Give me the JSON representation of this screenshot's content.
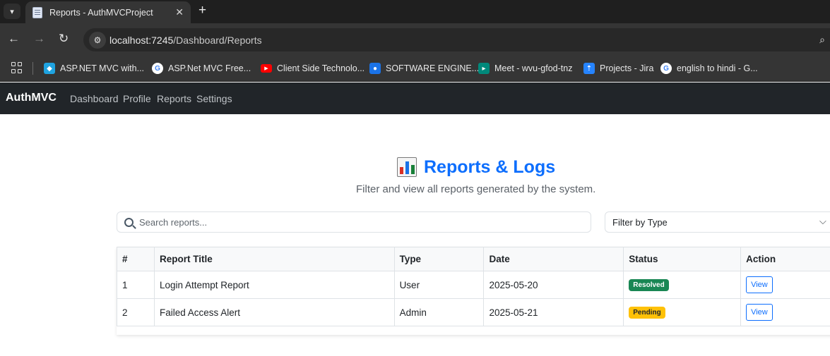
{
  "browser": {
    "tab_title": "Reports - AuthMVCProject",
    "tab_close": "✕",
    "new_tab": "+",
    "url_host": "localhost:7245",
    "url_path": "/Dashboard/Reports",
    "bookmarks": [
      {
        "label": "ASP.NET MVC with...",
        "icon": "layers-icon",
        "color": "#1fa3e0"
      },
      {
        "label": "ASP.Net MVC Free...",
        "icon": "google-icon",
        "color": "#ffffff"
      },
      {
        "label": "Client Side Technolo...",
        "icon": "youtube-icon",
        "color": "#ff0000"
      },
      {
        "label": "SOFTWARE ENGINE...",
        "icon": "classroom-icon",
        "color": "#1e8e3e"
      },
      {
        "label": "Meet - wvu-gfod-tnz",
        "icon": "meet-icon",
        "color": "#00897b"
      },
      {
        "label": "Projects - Jira",
        "icon": "jira-icon",
        "color": "#2684ff"
      },
      {
        "label": "english to hindi - G...",
        "icon": "google-icon",
        "color": "#ffffff"
      }
    ]
  },
  "app": {
    "brand": "AuthMVC",
    "nav": [
      "Dashboard",
      "Profile",
      "Reports",
      "Settings"
    ]
  },
  "page": {
    "title": "Reports & Logs",
    "subtitle": "Filter and view all reports generated by the system.",
    "search_placeholder": "Search reports...",
    "filter_selected": "Filter by Type"
  },
  "table": {
    "headers": [
      "#",
      "Report Title",
      "Type",
      "Date",
      "Status",
      "Action"
    ],
    "rows": [
      {
        "num": "1",
        "title": "Login Attempt Report",
        "type": "User",
        "date": "2025-05-20",
        "status": "Resolved",
        "action": "View"
      },
      {
        "num": "2",
        "title": "Failed Access Alert",
        "type": "Admin",
        "date": "2025-05-21",
        "status": "Pending",
        "action": "View"
      }
    ]
  },
  "colors": {
    "accent": "#0d6efd",
    "navbar": "#212529",
    "resolved": "#198754",
    "pending": "#ffc107"
  }
}
